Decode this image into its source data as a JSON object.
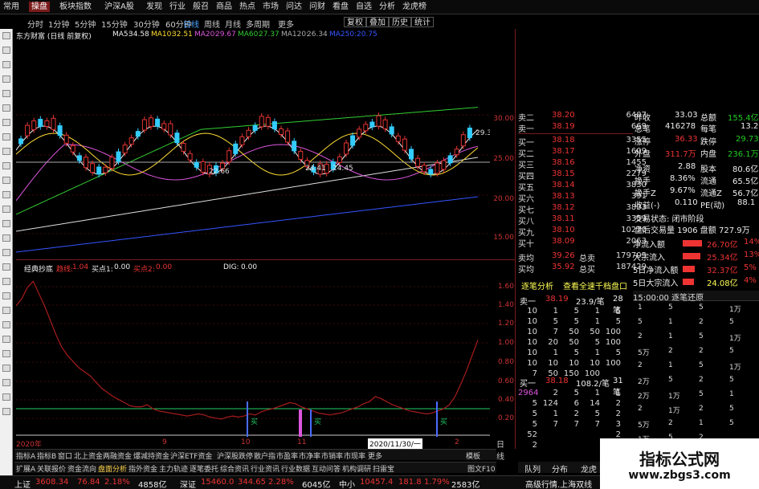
{
  "menubar": {
    "items": [
      "常用",
      "操盘",
      "板块指数",
      "沪深A股",
      "发现",
      "行业",
      "般召",
      "商品",
      "热点",
      "市场",
      "问达",
      "问财",
      "看盘",
      "自选",
      "分析",
      "龙虎榜"
    ],
    "active_index": 1
  },
  "periods": [
    "分时",
    "1分钟",
    "5分钟",
    "15分钟",
    "30分钟",
    "60分钟",
    "日线",
    "周线",
    "月线",
    "多周期",
    "更多"
  ],
  "active_period_index": 6,
  "right_buttons": [
    "复权",
    "叠加",
    "历史",
    "统计"
  ],
  "stock_title": "东方财富 (日线 前复权)",
  "ma": [
    {
      "label": "MA5:",
      "value": "34.58",
      "color": "#eeeeee"
    },
    {
      "label": "MA10:",
      "value": "32.51",
      "color": "#ffdd33"
    },
    {
      "label": "MA20:",
      "value": "29.67",
      "color": "#dd55dd"
    },
    {
      "label": "MA60:",
      "value": "27.37",
      "color": "#33cc33"
    },
    {
      "label": "MA120:",
      "value": "26.34",
      "color": "#aaaaaa"
    },
    {
      "label": "MA250:",
      "value": "20.75",
      "color": "#3355ff"
    }
  ],
  "price_axis": [
    "30.00",
    "25.00",
    "20.00",
    "15.00"
  ],
  "price_annotations": [
    "22.66",
    "24.41",
    "24.45",
    "29.3"
  ],
  "indicator": {
    "name": "经典抄底",
    "items": [
      {
        "label": "趋线:",
        "value": "1.04",
        "color": "#e33333"
      },
      {
        "label": "买点1:",
        "value": "0.00",
        "color": "#eeeeee"
      },
      {
        "label": "买点2:",
        "value": "0.00",
        "color": "#e33333"
      },
      {
        "label": "DIG:",
        "value": "0.00",
        "color": "#eeeeee"
      }
    ],
    "axis": [
      "1.60",
      "1.40",
      "1.20",
      "1.00",
      "0.80",
      "0.60",
      "0.40",
      "0.20"
    ],
    "buy_labels": [
      "买",
      "买",
      "买"
    ]
  },
  "chart_data": {
    "type": "line",
    "title": "经典抄底",
    "ylim": [
      0.1,
      1.7
    ],
    "series": [
      {
        "name": "趋线",
        "color": "#a81c1c",
        "values": [
          1.38,
          1.45,
          1.56,
          1.62,
          1.5,
          1.38,
          1.24,
          1.1,
          0.98,
          0.9,
          0.84,
          0.78,
          0.74,
          0.7,
          0.64,
          0.58,
          0.54,
          0.5,
          0.47,
          0.44,
          0.41,
          0.4,
          0.4,
          0.42,
          0.38,
          0.36,
          0.35,
          0.34,
          0.33,
          0.32,
          0.31,
          0.32,
          0.33,
          0.32,
          0.3,
          0.29,
          0.28,
          0.3,
          0.31,
          0.3,
          0.31,
          0.33,
          0.32,
          0.35,
          0.37,
          0.38,
          0.4,
          0.42,
          0.44,
          0.43,
          0.4,
          0.38,
          0.36,
          0.34,
          0.33,
          0.32,
          0.33,
          0.34,
          0.36,
          0.38,
          0.4,
          0.43,
          0.45,
          0.5,
          0.48,
          0.45,
          0.42,
          0.4,
          0.38,
          0.36,
          0.35,
          0.34,
          0.33,
          0.34,
          0.36,
          0.38,
          0.42,
          0.5,
          0.62,
          0.75,
          0.9,
          1.05
        ]
      }
    ]
  },
  "dates": {
    "first": "2020年",
    "m9": "9",
    "m10": "10",
    "m11": "11",
    "current": "2020/11/30/一",
    "m2": "2",
    "period": "日线"
  },
  "tabrow1": [
    "指标A",
    "指标B",
    "窗口",
    "北上资金",
    "两融资金",
    "爆减持资金",
    "沪深ETF资金",
    "沪深股跌停",
    "散户指",
    "市盈率",
    "市净率",
    "市销率",
    "市现率",
    "更多"
  ],
  "tabrow2": [
    "扩展A",
    "关联报价",
    "资金流向",
    "盘面分析",
    "指外资金",
    "主力轨迹",
    "逐笔委托",
    "综合资讯",
    "行业资讯",
    "行业数据",
    "互动问答",
    "机构调研",
    "扫雷宝"
  ],
  "tabrow2_extra": [
    "图文F10",
    "模板"
  ],
  "orderbook": {
    "sell": [
      {
        "label": "卖二",
        "price": "38.20",
        "vol": "6407"
      },
      {
        "label": "卖一",
        "price": "38.19",
        "vol": "669"
      }
    ],
    "buy": [
      {
        "label": "买一",
        "price": "38.18",
        "vol": "3355"
      },
      {
        "label": "买二",
        "price": "38.17",
        "vol": "1609"
      },
      {
        "label": "买三",
        "price": "38.16",
        "vol": "1455"
      },
      {
        "label": "买四",
        "price": "38.15",
        "vol": "2279"
      },
      {
        "label": "买五",
        "price": "38.14",
        "vol": "3830"
      },
      {
        "label": "买六",
        "price": "38.13",
        "vol": "391"
      },
      {
        "label": "买七",
        "price": "38.12",
        "vol": "3833"
      },
      {
        "label": "买八",
        "price": "38.11",
        "vol": "3359"
      },
      {
        "label": "买九",
        "price": "38.10",
        "vol": "10270"
      },
      {
        "label": "买十",
        "price": "38.09",
        "vol": "2063"
      }
    ],
    "avg": [
      {
        "label": "卖均",
        "price": "39.26",
        "tag": "总卖",
        "vol": "179705"
      },
      {
        "label": "买均",
        "price": "35.92",
        "tag": "总买",
        "vol": "187429"
      }
    ]
  },
  "stats": [
    {
      "k1": "昨收",
      "v1": "33.03",
      "k2": "总额",
      "v2": "155.4亿"
    },
    {
      "k1": "总笔",
      "v1": "416278",
      "k2": "每笔",
      "v2": "13.2"
    },
    {
      "k1": "涨停",
      "v1": "36.33",
      "k2": "跌停",
      "v2": "29.73"
    },
    {
      "k1": "外盘",
      "v1": "311.7万",
      "k2": "内盘",
      "v2": "236.1万"
    },
    {
      "k1": "净资",
      "v1": "2.88",
      "k2": "股本",
      "v2": "80.6亿"
    },
    {
      "k1": "换手",
      "v1": "8.36%",
      "k2": "流通",
      "v2": "65.5亿"
    },
    {
      "k1": "换手Z",
      "v1": "9.67%",
      "k2": "流通Z",
      "v2": "56.7亿"
    },
    {
      "k1": "收益(-)",
      "v1": "0.110",
      "k2": "PE(动)",
      "v2": "88.1"
    }
  ],
  "trade_status": "交易状态: 闭市阶段",
  "after_hours": "盘后交易量 1906 盘额 727.9万",
  "flows": [
    {
      "label": "净流入额",
      "value": "26.70亿",
      "pct": "14%",
      "bar": 0.85
    },
    {
      "label": "大宗流入",
      "value": "25.34亿",
      "pct": "13%",
      "bar": 0.8
    },
    {
      "label": "5日净流入额",
      "value": "32.37亿",
      "pct": "5%",
      "bar": 0.55
    },
    {
      "label": "5日大宗流入",
      "value": "24.08亿",
      "pct": "4%",
      "bar": 0.5
    }
  ],
  "zbuttons": [
    "逐笔分析",
    "查看全速千档盘口"
  ],
  "deal": {
    "sell_header": {
      "label": "卖一",
      "price": "38.19",
      "vol": "23.9/笔",
      "count": "28笔"
    },
    "sell_rows": [
      [
        "10",
        "1",
        "5",
        "1",
        "5"
      ],
      [
        "10",
        "5",
        "5",
        "1",
        "5"
      ],
      [
        "10",
        "7",
        "50",
        "50",
        "100"
      ],
      [
        "10",
        "20",
        "50",
        "5",
        "100"
      ],
      [
        "10",
        "1",
        "5",
        "1",
        "5"
      ],
      [
        "10",
        "10",
        "10",
        "10",
        "100"
      ],
      [
        "7",
        "50",
        "150",
        "100",
        ""
      ]
    ],
    "buy_header": {
      "label": "买一",
      "price": "38.18",
      "vol": "108.2/笔",
      "count": "31笔"
    },
    "buy_rows": [
      [
        "2964",
        "2",
        "5",
        "1",
        "1"
      ],
      [
        "5",
        "124",
        "6",
        "14",
        "2"
      ],
      [
        "5",
        "1",
        "2",
        "5",
        "2"
      ],
      [
        "5",
        "7",
        "7",
        "7",
        "3"
      ],
      [
        "52",
        "",
        "",
        "",
        "2"
      ],
      [
        "2",
        "",
        "",
        "",
        "1"
      ]
    ]
  },
  "ticks_header": "15:00:00 逐笔还原",
  "tick_values": [
    "1",
    "5",
    "5",
    "1万",
    "5",
    "1",
    "2",
    "5",
    "2",
    "1",
    "5",
    "1万",
    "5万",
    "2",
    "2",
    "5",
    "2",
    "1",
    "5",
    "1万",
    "2万",
    "5",
    "2",
    "5",
    "2万",
    "1万",
    "5",
    "1",
    "2",
    "1万",
    "2",
    "5",
    "5万",
    "2",
    "1",
    "5",
    "1万",
    "5",
    "2"
  ],
  "bottomtabs": [
    "队列",
    "分布",
    "龙虎"
  ],
  "status": {
    "sh_label": "上证",
    "sh_val": "3608.34",
    "sh_chg": "76.84",
    "sh_pct": "2.18%",
    "sh_amt": "4858亿",
    "sz_label": "深证",
    "sz_val": "15460.0",
    "sz_chg": "344.65",
    "sz_pct": "2.28%",
    "sz_amt": "6045亿",
    "zx_label": "中小",
    "zx_val": "10457.4",
    "zx_chg": "181.8",
    "zx_pct": "1.79%",
    "zx_amt": "2583亿",
    "extra": "高级行情.上海双线"
  },
  "watermark": {
    "line1": "指标公式网",
    "line2": "www.zbgs3.com"
  }
}
